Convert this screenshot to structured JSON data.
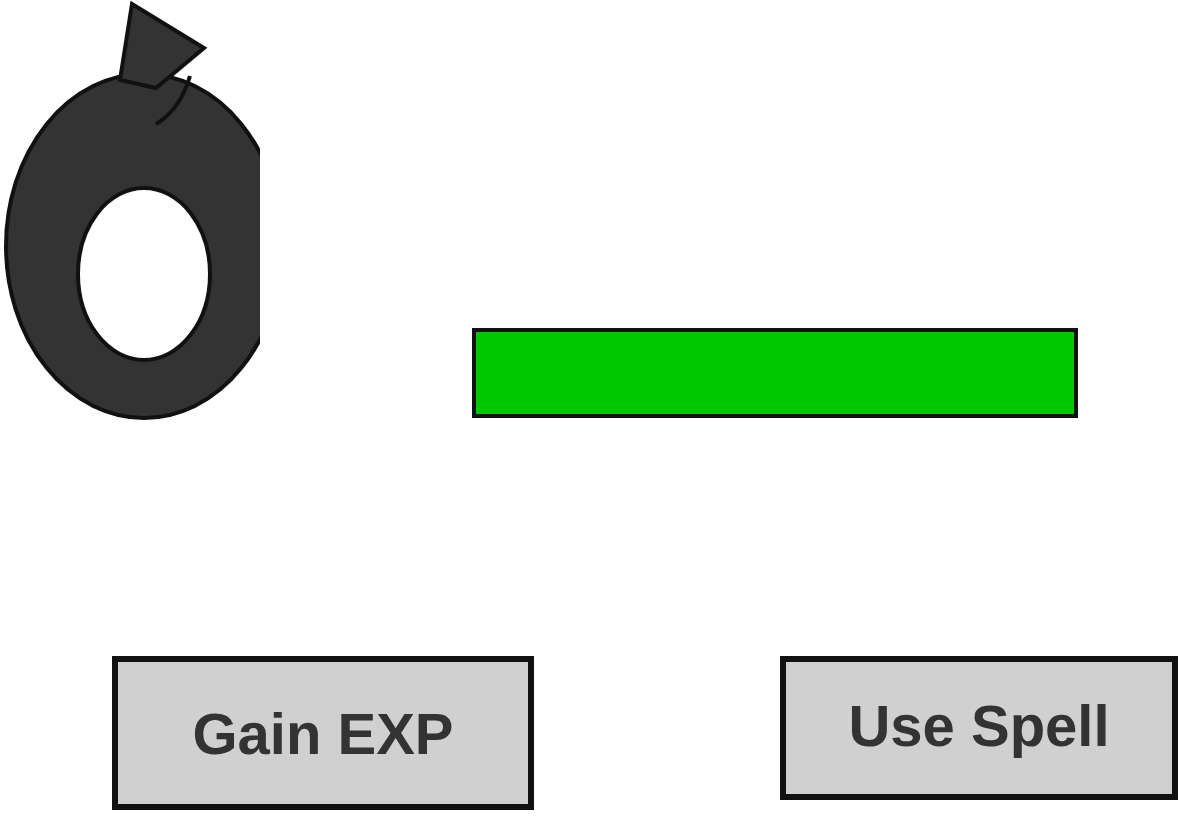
{
  "buttons": [
    {
      "label": "Gain EXP"
    },
    {
      "label": "Use Spell"
    }
  ]
}
